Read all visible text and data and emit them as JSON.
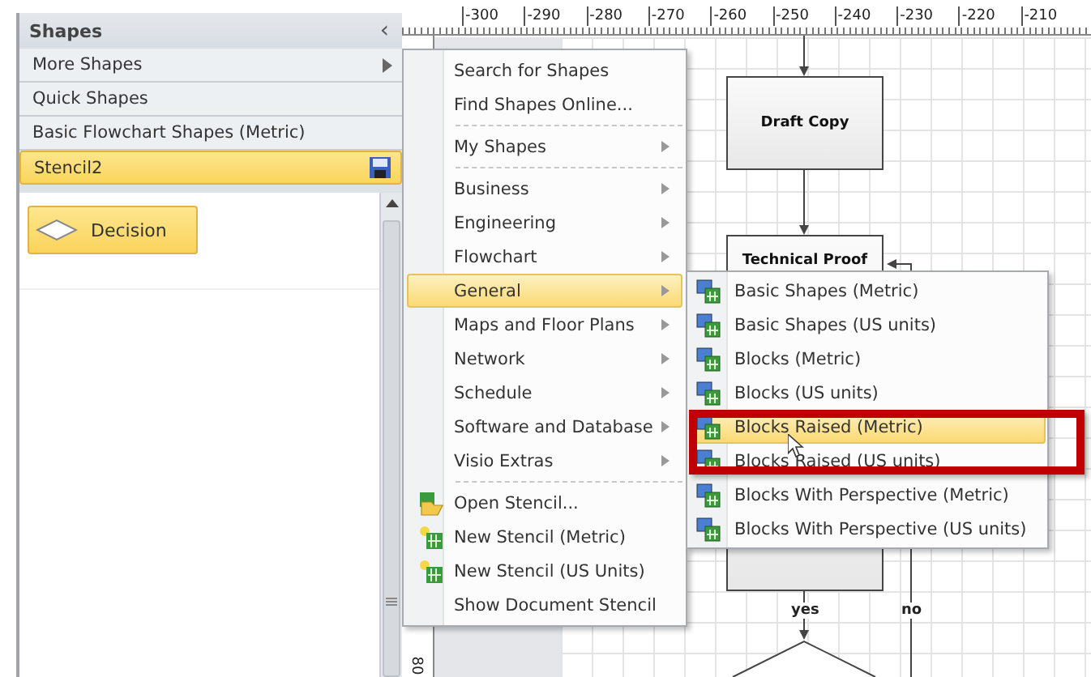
{
  "shapes_panel": {
    "title": "Shapes",
    "collapse_glyph": "‹",
    "items": [
      {
        "label": "More Shapes",
        "kind": "submenu",
        "selected": false
      },
      {
        "label": "Quick Shapes",
        "kind": "plain",
        "selected": false
      },
      {
        "label": "Basic Flowchart Shapes (Metric)",
        "kind": "plain",
        "selected": false
      },
      {
        "label": "Stencil2",
        "kind": "stencil",
        "selected": true
      }
    ],
    "masters": [
      {
        "label": "Decision",
        "selected": true
      }
    ]
  },
  "ruler": {
    "labels": [
      "-300",
      "-290",
      "-280",
      "-270",
      "-260",
      "-250",
      "-240",
      "-230",
      "-220",
      "-210"
    ],
    "vertical_label": "80"
  },
  "diagram": {
    "boxes": [
      {
        "label": "Draft Copy"
      },
      {
        "label": "Technical Proof"
      }
    ],
    "connector_labels": [
      "yes",
      "no"
    ]
  },
  "menu": {
    "items": [
      {
        "kind": "item",
        "label": "Search for Shapes",
        "submenu": false,
        "selected": false
      },
      {
        "kind": "item",
        "label": "Find Shapes Online...",
        "submenu": false,
        "selected": false
      },
      {
        "kind": "separator"
      },
      {
        "kind": "item",
        "label": "My Shapes",
        "submenu": true,
        "selected": false
      },
      {
        "kind": "separator"
      },
      {
        "kind": "item",
        "label": "Business",
        "submenu": true,
        "selected": false
      },
      {
        "kind": "item",
        "label": "Engineering",
        "submenu": true,
        "selected": false
      },
      {
        "kind": "item",
        "label": "Flowchart",
        "submenu": true,
        "selected": false
      },
      {
        "kind": "item",
        "label": "General",
        "submenu": true,
        "selected": true
      },
      {
        "kind": "item",
        "label": "Maps and Floor Plans",
        "submenu": true,
        "selected": false
      },
      {
        "kind": "item",
        "label": "Network",
        "submenu": true,
        "selected": false
      },
      {
        "kind": "item",
        "label": "Schedule",
        "submenu": true,
        "selected": false
      },
      {
        "kind": "item",
        "label": "Software and Database",
        "submenu": true,
        "selected": false
      },
      {
        "kind": "item",
        "label": "Visio Extras",
        "submenu": true,
        "selected": false
      },
      {
        "kind": "separator"
      },
      {
        "kind": "open",
        "label": "Open Stencil...",
        "submenu": false,
        "selected": false
      },
      {
        "kind": "new",
        "label": "New Stencil (Metric)",
        "submenu": false,
        "selected": false
      },
      {
        "kind": "new",
        "label": "New Stencil (US Units)",
        "submenu": false,
        "selected": false
      },
      {
        "kind": "item",
        "label": "Show Document Stencil",
        "submenu": false,
        "selected": false
      }
    ]
  },
  "submenu": {
    "items": [
      {
        "label": "Basic Shapes (Metric)",
        "selected": false
      },
      {
        "label": "Basic Shapes (US units)",
        "selected": false
      },
      {
        "label": "Blocks (Metric)",
        "selected": false
      },
      {
        "label": "Blocks (US units)",
        "selected": false
      },
      {
        "label": "Blocks Raised (Metric)",
        "selected": true
      },
      {
        "label": "Blocks Raised (US units)",
        "selected": false
      },
      {
        "label": "Blocks With Perspective (Metric)",
        "selected": false
      },
      {
        "label": "Blocks With Perspective (US units)",
        "selected": false
      }
    ]
  }
}
